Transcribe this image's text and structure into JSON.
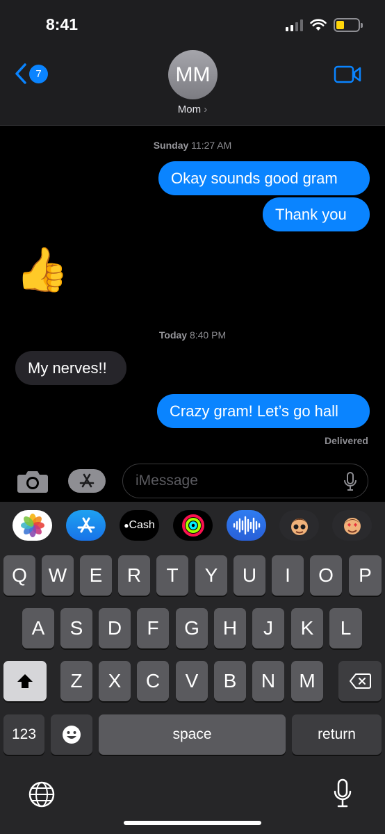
{
  "status": {
    "time": "8:41"
  },
  "header": {
    "back_count": "7",
    "avatar_initials": "MM",
    "contact_name": "Mom",
    "contact_chevron": "›"
  },
  "thread": {
    "timestamp1_day": "Sunday",
    "timestamp1_time": "11:27 AM",
    "msg1": "Okay sounds good gram",
    "msg2": "Thank you",
    "reaction": "👍",
    "timestamp2_day": "Today",
    "timestamp2_time": "8:40 PM",
    "msg3": "My nerves!!",
    "msg4": "Crazy gram! Let’s go hall",
    "delivered": "Delivered"
  },
  "composer": {
    "placeholder": "iMessage"
  },
  "apps": {
    "cash_label": "Cash"
  },
  "keyboard": {
    "row1": [
      "Q",
      "W",
      "E",
      "R",
      "T",
      "Y",
      "U",
      "I",
      "O",
      "P"
    ],
    "row2": [
      "A",
      "S",
      "D",
      "F",
      "G",
      "H",
      "J",
      "K",
      "L"
    ],
    "row3": [
      "Z",
      "X",
      "C",
      "V",
      "B",
      "N",
      "M"
    ],
    "numbers": "123",
    "space": "space",
    "return": "return"
  },
  "colors": {
    "accent": "#0a84ff",
    "incoming": "#26252a"
  },
  "icons": [
    "signal-icon",
    "wifi-icon",
    "battery-icon",
    "back-chevron-icon",
    "video-camera-icon",
    "camera-icon",
    "app-store-icon",
    "microphone-icon",
    "photos-icon",
    "activity-icon",
    "audio-icon",
    "memoji-icon",
    "shift-icon",
    "delete-icon",
    "emoji-icon",
    "globe-icon",
    "dictation-icon"
  ]
}
